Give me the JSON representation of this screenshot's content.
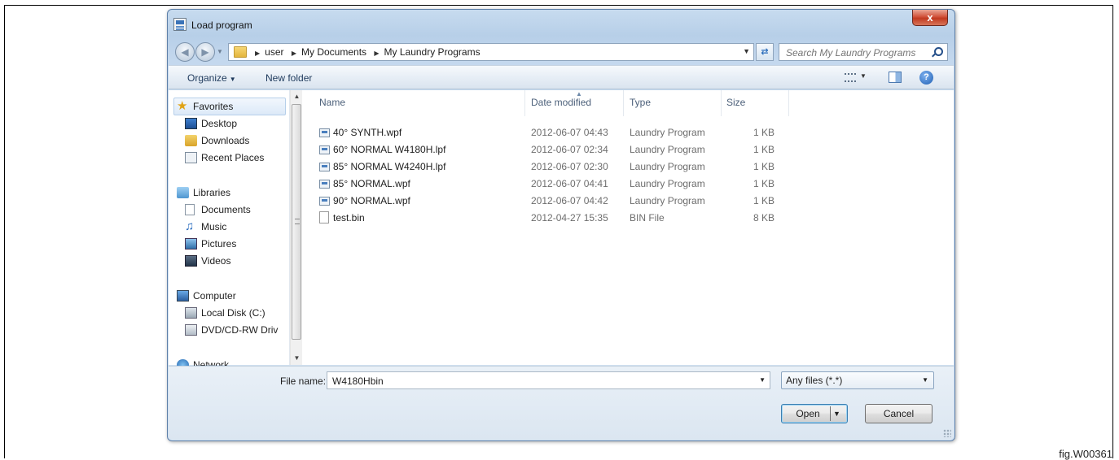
{
  "window": {
    "title": "Load program",
    "close_label": "x"
  },
  "address": {
    "crumbs": [
      "user",
      "My Documents",
      "My Laundry Programs"
    ],
    "search_placeholder": "Search My Laundry Programs"
  },
  "toolbar": {
    "organize_label": "Organize",
    "new_folder_label": "New folder",
    "help_label": "?"
  },
  "sidebar": {
    "items": [
      {
        "label": "Favorites",
        "icon": "star-icon"
      },
      {
        "label": "Desktop",
        "icon": "desktop-icon"
      },
      {
        "label": "Downloads",
        "icon": "downloads-icon"
      },
      {
        "label": "Recent Places",
        "icon": "recent-places-icon"
      },
      {
        "label": "Libraries",
        "icon": "libraries-icon"
      },
      {
        "label": "Documents",
        "icon": "documents-icon"
      },
      {
        "label": "Music",
        "icon": "music-icon"
      },
      {
        "label": "Pictures",
        "icon": "pictures-icon"
      },
      {
        "label": "Videos",
        "icon": "videos-icon"
      },
      {
        "label": "Computer",
        "icon": "computer-icon"
      },
      {
        "label": "Local Disk (C:)",
        "icon": "local-disk-icon"
      },
      {
        "label": "DVD/CD-RW Driv",
        "icon": "dvd-drive-icon"
      },
      {
        "label": "Network",
        "icon": "network-icon"
      }
    ]
  },
  "files": {
    "columns": [
      "Name",
      "Date modified",
      "Type",
      "Size"
    ],
    "rows": [
      {
        "name": "40° SYNTH.wpf",
        "date": "2012-06-07 04:43",
        "type": "Laundry Program",
        "size": "1 KB"
      },
      {
        "name": "60° NORMAL W4180H.lpf",
        "date": "2012-06-07 02:34",
        "type": "Laundry Program",
        "size": "1 KB"
      },
      {
        "name": "85° NORMAL W4240H.lpf",
        "date": "2012-06-07 02:30",
        "type": "Laundry Program",
        "size": "1 KB"
      },
      {
        "name": "85° NORMAL.wpf",
        "date": "2012-06-07 04:41",
        "type": "Laundry Program",
        "size": "1 KB"
      },
      {
        "name": "90° NORMAL.wpf",
        "date": "2012-06-07 04:42",
        "type": "Laundry Program",
        "size": "1 KB"
      },
      {
        "name": "test.bin",
        "date": "2012-04-27 15:35",
        "type": "BIN File",
        "size": "8 KB"
      }
    ]
  },
  "footer": {
    "file_name_label": "File name:",
    "file_name_value": "W4180Hbin",
    "file_type_value": "Any files (*.*)",
    "open_label": "Open",
    "cancel_label": "Cancel"
  },
  "figure_label": "fig.W00361"
}
